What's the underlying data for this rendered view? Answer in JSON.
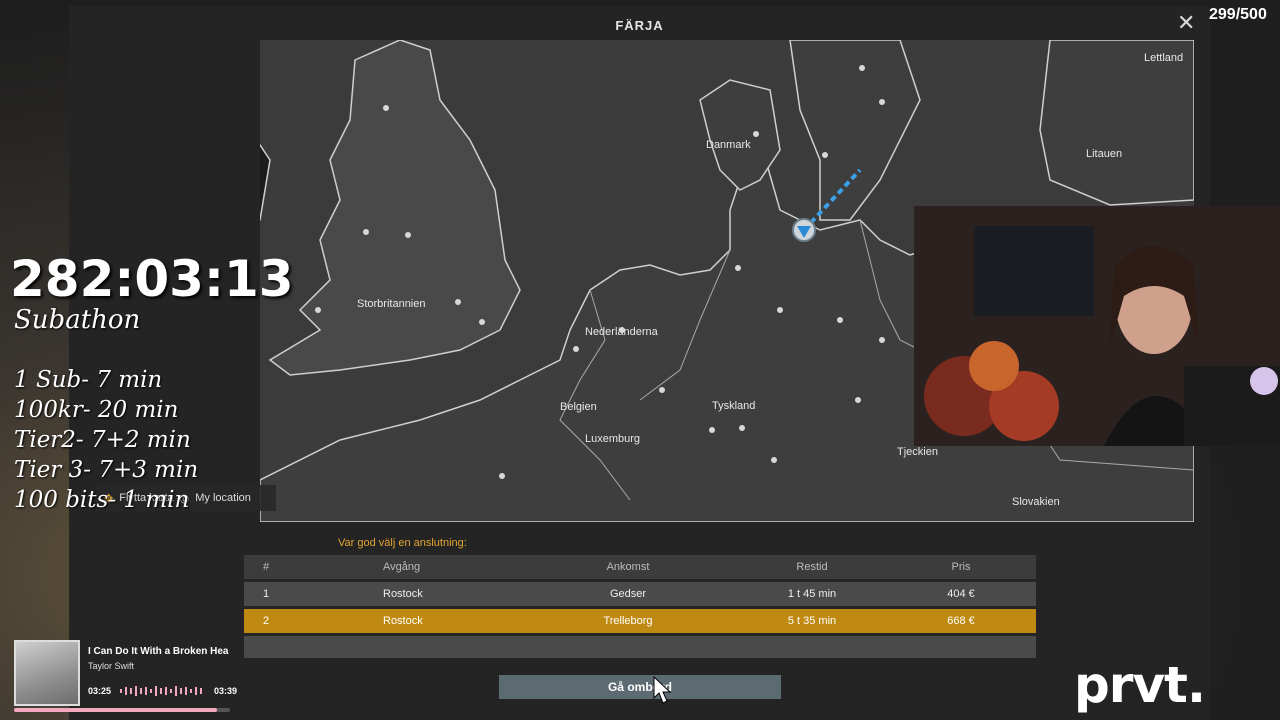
{
  "window": {
    "title": "FÄRJA",
    "close_label": "✕",
    "counter": "299/500"
  },
  "map": {
    "labels": {
      "lettland": "Lettland",
      "litauen": "Litauen",
      "danmark": "Danmark",
      "storbritannien": "Storbritannien",
      "nederlanderna": "Nederländerna",
      "belgien": "Belgien",
      "luxemburg": "Luxemburg",
      "tyskland": "Tyskland",
      "tjeckien": "Tjeckien",
      "slovakien": "Slovakien"
    },
    "controls": {
      "move_label": "Flytta karta",
      "location_label": "My location"
    }
  },
  "prompt": "Var god välj en anslutning:",
  "table": {
    "headers": [
      "#",
      "Avgång",
      "Ankomst",
      "Restid",
      "Pris"
    ],
    "rows": [
      {
        "num": "1",
        "from": "Rostock",
        "to": "Gedser",
        "time": "1 t 45 min",
        "price": "404 €"
      },
      {
        "num": "2",
        "from": "Rostock",
        "to": "Trelleborg",
        "time": "5 t 35 min",
        "price": "668 €"
      }
    ]
  },
  "board_button": "Gå ombord",
  "overlay": {
    "timer": "282:03:13",
    "subathon": "Subathon",
    "rules": [
      "1 Sub- 7 min",
      "100kr- 20 min",
      "Tier2- 7+2 min",
      "Tier 3- 7+3 min",
      "100 bits- 1 min"
    ]
  },
  "music": {
    "song": "I Can Do It With a Broken Hea",
    "artist": "Taylor Swift",
    "elapsed": "03:25",
    "total": "03:39",
    "progress": 0.94
  },
  "logo": "prvt.",
  "colors": {
    "accent": "#c08a12",
    "prompt": "#e2a533",
    "button": "#5c6b72",
    "route": "#3aa0e8"
  }
}
